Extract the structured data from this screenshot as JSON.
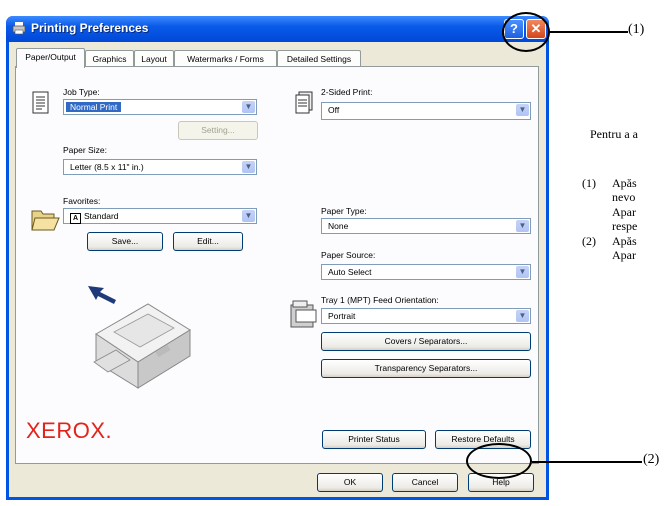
{
  "window": {
    "title": "Printing Preferences",
    "help_glyph": "?",
    "close_glyph": "✕"
  },
  "tabs": [
    {
      "label": "Paper/Output",
      "active": true
    },
    {
      "label": "Graphics"
    },
    {
      "label": "Layout"
    },
    {
      "label": "Watermarks / Forms"
    },
    {
      "label": "Detailed Settings"
    }
  ],
  "paper_output": {
    "job_type": {
      "label": "Job Type:",
      "value": "Normal Print"
    },
    "setting_button": "Setting...",
    "paper_size": {
      "label": "Paper Size:",
      "value": "Letter (8.5 x 11\" in.)"
    },
    "favorites": {
      "label": "Favorites:",
      "value": "Standard",
      "value_icon": "A"
    },
    "save_button": "Save...",
    "edit_button": "Edit...",
    "two_sided": {
      "label": "2-Sided Print:",
      "value": "Off"
    },
    "paper_type": {
      "label": "Paper Type:",
      "value": "None"
    },
    "paper_source": {
      "label": "Paper Source:",
      "value": "Auto Select"
    },
    "feed_orientation": {
      "label": "Tray 1 (MPT) Feed Orientation:",
      "value": "Portrait"
    },
    "covers_button": "Covers / Separators...",
    "transparency_button": "Transparency Separators...",
    "brand_logo": "XEROX.",
    "printer_status_button": "Printer Status",
    "restore_defaults_button": "Restore Defaults"
  },
  "dialog_buttons": {
    "ok": "OK",
    "cancel": "Cancel",
    "help": "Help"
  },
  "annotations": {
    "callout_1": "(1)",
    "callout_2": "(2)"
  },
  "side_text": {
    "intro": "Pentru a a",
    "item1_num": "(1)",
    "item1_line1": "Apăs",
    "item1_line2": "nevo",
    "item1_line3": "Apar",
    "item1_line4": "respe",
    "item2_num": "(2)",
    "item2_line1": "Apăs",
    "item2_line2": "Apar"
  },
  "colors": {
    "titlebar": "#0054e3",
    "selection": "#316ac5",
    "xerox_red": "#e2231a",
    "dialog_face": "#ece9d8"
  }
}
